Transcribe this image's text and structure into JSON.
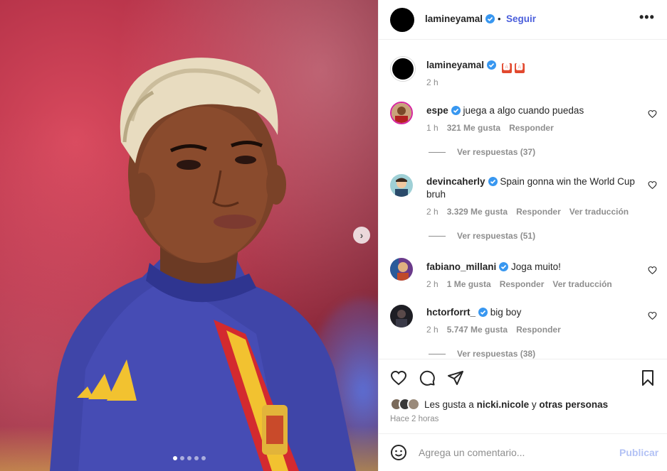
{
  "post": {
    "author": "lamineyamal",
    "follow_sep": "•",
    "follow_label": "Seguir",
    "more_label": "•••",
    "caption_flags": [
      "🅰",
      "🅰"
    ],
    "caption_time": "2 h",
    "image_icons": [
      "chevron-right-icon"
    ],
    "carousel": {
      "count": 5,
      "active_index": 0
    }
  },
  "comments": [
    {
      "user": "espe",
      "text": "juega a algo cuando puedas",
      "time": "1 h",
      "likes": "321 Me gusta",
      "reply": "Responder",
      "translate": "",
      "replies": "Ver respuestas (37)"
    },
    {
      "user": "devincaherly",
      "text": "Spain gonna win the World Cup bruh",
      "time": "2 h",
      "likes": "3.329 Me gusta",
      "reply": "Responder",
      "translate": "Ver traducción",
      "replies": "Ver respuestas (51)"
    },
    {
      "user": "fabiano_millani",
      "text": "Joga muito!",
      "time": "2 h",
      "likes": "1 Me gusta",
      "reply": "Responder",
      "translate": "Ver traducción",
      "replies": ""
    },
    {
      "user": "hctorforrt_",
      "text": "big boy",
      "time": "2 h",
      "likes": "5.747 Me gusta",
      "reply": "Responder",
      "translate": "",
      "replies": "Ver respuestas (38)"
    }
  ],
  "likes": {
    "prefix": "Les gusta a",
    "user": "nicki.nicole",
    "join": "y",
    "others": "otras personas",
    "time_ago": "Hace 2 horas"
  },
  "comment_box": {
    "placeholder": "Agrega un comentario...",
    "publish_label": "Publicar"
  },
  "colors": {
    "accent": "#4a5edb",
    "verified": "#3897f0",
    "publish_disabled": "#b3c2f5",
    "muted": "#8e8e8e"
  }
}
